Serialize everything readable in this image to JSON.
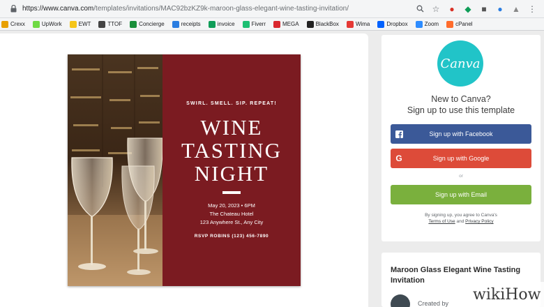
{
  "browser": {
    "url_host": "https://www.canva.com",
    "url_path": "/templates/invitations/MAC92bzKZ9k-maroon-glass-elegant-wine-tasting-invitation/",
    "toolbar_icons": [
      "search-icon",
      "star-icon",
      "evernote-icon",
      "extension-icon",
      "extension-icon",
      "extension-icon",
      "extension-icon",
      "menu-icon"
    ]
  },
  "bookmarks": [
    {
      "label": "Crexx",
      "color": "#e8a000"
    },
    {
      "label": "UpWork",
      "color": "#6fda44"
    },
    {
      "label": "EWT",
      "color": "#f5c518"
    },
    {
      "label": "TTOF",
      "color": "#444444"
    },
    {
      "label": "Concierge",
      "color": "#1a8f3a"
    },
    {
      "label": "receipts",
      "color": "#2a7de1"
    },
    {
      "label": "invoice",
      "color": "#0f9d58"
    },
    {
      "label": "Fiverr",
      "color": "#1dbf73"
    },
    {
      "label": "MEGA",
      "color": "#d9272e"
    },
    {
      "label": "BlackBox",
      "color": "#222222"
    },
    {
      "label": "Wima",
      "color": "#e53935"
    },
    {
      "label": "Dropbox",
      "color": "#0061fe"
    },
    {
      "label": "Zoom",
      "color": "#2d8cff"
    },
    {
      "label": "cPanel",
      "color": "#ff6c2c"
    }
  ],
  "invitation": {
    "tagline": "SWIRL. SMELL. SIP. REPEAT!",
    "title_lines": [
      "WINE",
      "TASTING",
      "NIGHT"
    ],
    "date_time": "May 20, 2023 • 6PM",
    "venue": "The Chateau Hotel",
    "address": "123 Anywhere St., Any City",
    "rsvp": "RSVP ROBINS (123) 456-7890",
    "maroon_color": "#7b1b21"
  },
  "signup": {
    "logo_text": "Canva",
    "title_line1": "New to Canva?",
    "title_line2": "Sign up to use this template",
    "facebook_label": "Sign up with Facebook",
    "google_label": "Sign up with Google",
    "or_label": "or",
    "email_label": "Sign up with Email",
    "legal_text": "By signing up, you agree to Canva's",
    "terms_label": "Terms of Use",
    "and_label": "and",
    "privacy_label": "Privacy Policy",
    "colors": {
      "facebook": "#3b5998",
      "google": "#dd4b39",
      "email": "#7ab03d",
      "logo": "#21c4c8"
    }
  },
  "template_info": {
    "name": "Maroon Glass Elegant Wine Tasting Invitation",
    "created_by": "Created by"
  },
  "watermark": "wikiHow"
}
